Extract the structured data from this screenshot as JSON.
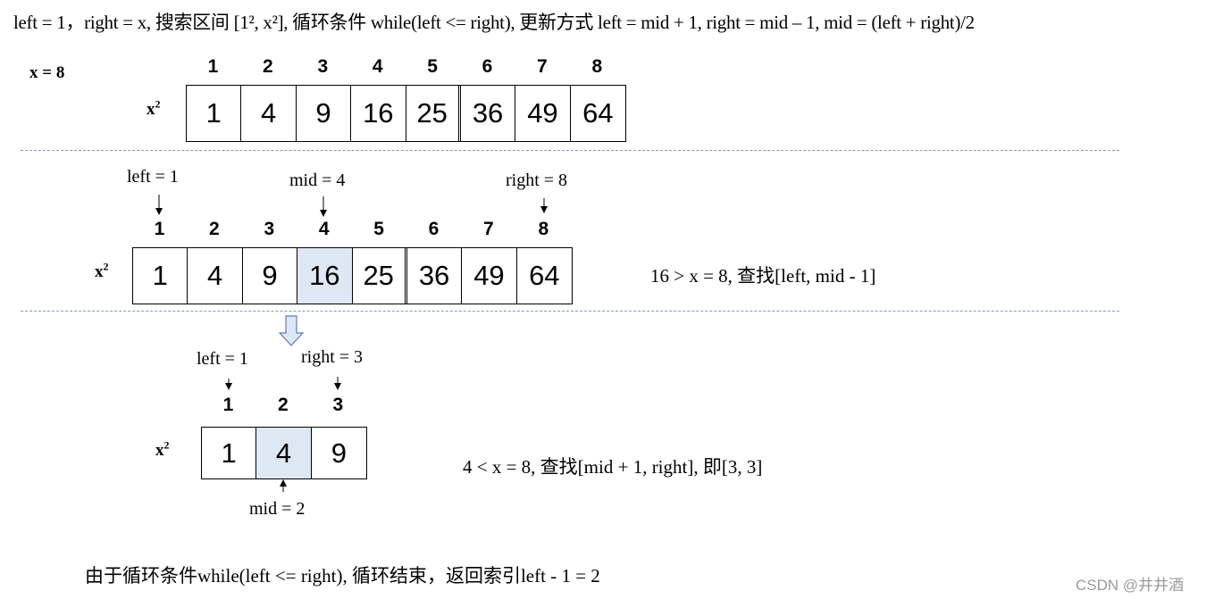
{
  "title": "left = 1，right = x, 搜索区间 [1², x²], 循环条件 while(left <= right), 更新方式 left = mid + 1, right = mid – 1, mid = (left + right)/2",
  "x_label": "x = 8",
  "row_label": "x",
  "row_label_sup": "2",
  "step1": {
    "indices": [
      "1",
      "2",
      "3",
      "4",
      "5",
      "6",
      "7",
      "8"
    ],
    "values": [
      "1",
      "4",
      "9",
      "16",
      "25",
      "36",
      "49",
      "64"
    ]
  },
  "step2": {
    "pointers": {
      "left": "left = 1",
      "mid": "mid = 4",
      "right": "right = 8"
    },
    "indices": [
      "1",
      "2",
      "3",
      "4",
      "5",
      "6",
      "7",
      "8"
    ],
    "values": [
      "1",
      "4",
      "9",
      "16",
      "25",
      "36",
      "49",
      "64"
    ],
    "highlight_index": 4,
    "note": "16 > x = 8,  查找[left,  mid - 1]"
  },
  "step3": {
    "pointers": {
      "left": "left = 1",
      "right": "right = 3",
      "mid": "mid = 2"
    },
    "indices": [
      "1",
      "2",
      "3"
    ],
    "values": [
      "1",
      "4",
      "9"
    ],
    "highlight_index": 2,
    "note": "4 < x = 8,  查找[mid + 1,  right], 即[3, 3]"
  },
  "footer": "由于循环条件while(left <= right), 循环结束，返回索引left - 1 = 2",
  "watermark": "CSDN @井井酒",
  "colors": {
    "highlight": "#dee8f5",
    "dashed_line": "#7a9bd1",
    "hollow_arrow_fill": "#dee8f5",
    "hollow_arrow_stroke": "#5b7fc0"
  }
}
